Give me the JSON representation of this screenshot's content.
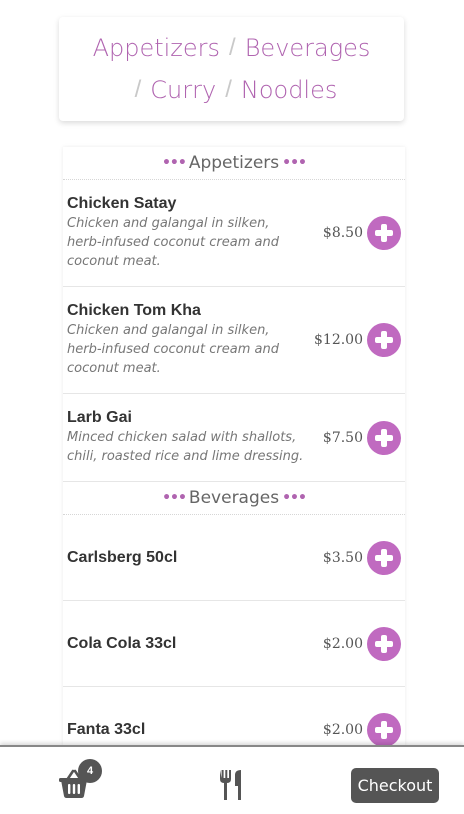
{
  "categories": {
    "appetizers": "Appetizers",
    "beverages": "Beverages",
    "curry": "Curry",
    "noodles": "Noodles",
    "separator": "/"
  },
  "sections": {
    "appetizers": {
      "title": "Appetizers",
      "items": [
        {
          "name": "Chicken Satay",
          "description": "Chicken and galangal in silken, herb-infused coconut cream and coconut meat.",
          "price": "$8.50"
        },
        {
          "name": "Chicken Tom Kha",
          "description": "Chicken and galangal in silken, herb-infused coconut cream and coconut meat.",
          "price": "$12.00"
        },
        {
          "name": "Larb Gai",
          "description": "Minced chicken salad with shallots, chili, roasted rice and lime dressing.",
          "price": "$7.50"
        }
      ]
    },
    "beverages": {
      "title": "Beverages",
      "items": [
        {
          "name": "Carlsberg 50cl",
          "price": "$3.50"
        },
        {
          "name": "Cola Cola 33cl",
          "price": "$2.00"
        },
        {
          "name": "Fanta 33cl",
          "price": "$2.00"
        }
      ]
    }
  },
  "section_dots": "•••",
  "bottom_bar": {
    "basket_count": "4",
    "checkout_label": "Checkout"
  },
  "colors": {
    "accent": "#c06ac0",
    "dark": "#555555"
  },
  "icons": [
    "plus-circle-icon",
    "basket-icon",
    "utensils-icon"
  ]
}
